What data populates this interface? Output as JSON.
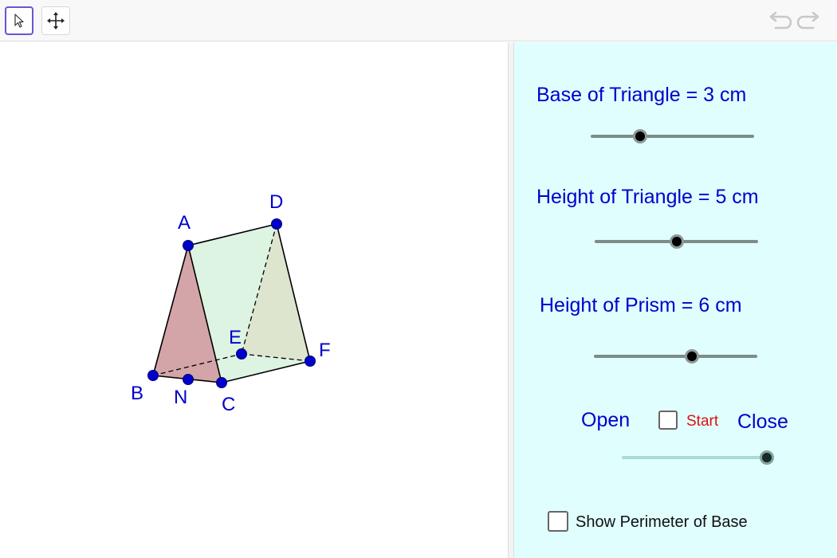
{
  "toolbar": {
    "tools": [
      {
        "name": "move-tool",
        "icon": "cursor-arrow-icon",
        "selected": true
      },
      {
        "name": "move-view-tool",
        "icon": "four-way-arrow-icon",
        "selected": false
      }
    ],
    "undo_icon": "undo-icon",
    "redo_icon": "redo-icon"
  },
  "figure": {
    "points": {
      "A": "A",
      "B": "B",
      "C": "C",
      "D": "D",
      "E": "E",
      "F": "F",
      "N": "N"
    }
  },
  "panel": {
    "base_slider": {
      "label": "Base of Triangle = 3 cm",
      "fraction": 0.3
    },
    "height_triangle_slider": {
      "label": "Height of Triangle = 5 cm",
      "fraction": 0.5
    },
    "height_prism_slider": {
      "label": "Height of Prism = 6 cm",
      "fraction": 0.6
    },
    "animation": {
      "open_label": "Open",
      "start_label": "Start",
      "close_label": "Close",
      "fraction": 1.0
    },
    "show_perimeter": {
      "label": "Show Perimeter of Base",
      "checked": false
    }
  },
  "colors": {
    "label_blue": "#0000cc",
    "start_red": "#dd1111",
    "panel_bg": "#e0fefe",
    "triangle_front": "#d4a5a8",
    "face_green": "#ddf4e2",
    "triangle_back": "#dde5cf",
    "point_blue": "#0000cc"
  }
}
